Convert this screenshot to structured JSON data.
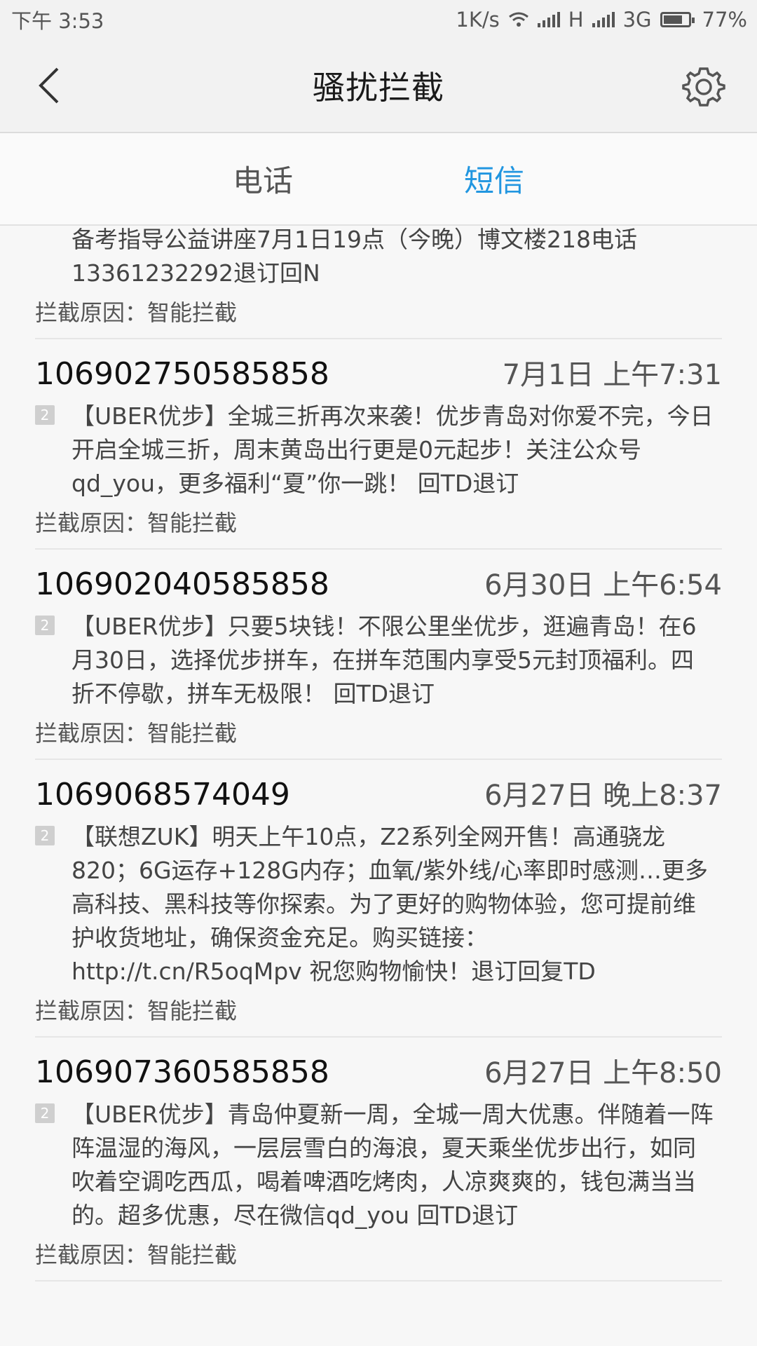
{
  "status_bar": {
    "time": "下午 3:53",
    "speed": "1K/s",
    "net1": "H",
    "net2": "3G",
    "battery": "77%",
    "battery_level": 0.77
  },
  "header": {
    "title": "骚扰拦截",
    "back_icon": "back-arrow-icon",
    "settings_icon": "gear-icon"
  },
  "tabs": [
    {
      "label": "电话",
      "active": false
    },
    {
      "label": "短信",
      "active": true
    }
  ],
  "messages": [
    {
      "number": "",
      "date": "",
      "sim": "",
      "text": "备考指导公益讲座7月1日19点（今晚）博文楼218电话13361232292退订回N",
      "reason": "拦截原因：智能拦截"
    },
    {
      "number": "106902750585858",
      "date": "7月1日 上午7:31",
      "sim": "2",
      "text": "【UBER优步】全城三折再次来袭！优步青岛对你爱不完，今日开启全城三折，周末黄岛出行更是0元起步！关注公众号qd_you，更多福利“夏”你一跳！ 回TD退订",
      "reason": "拦截原因：智能拦截"
    },
    {
      "number": "106902040585858",
      "date": "6月30日 上午6:54",
      "sim": "2",
      "text": "【UBER优步】只要5块钱！不限公里坐优步，逛遍青岛！在6月30日，选择优步拼车，在拼车范围内享受5元封顶福利。四折不停歇，拼车无极限！ 回TD退订",
      "reason": "拦截原因：智能拦截"
    },
    {
      "number": "1069068574049",
      "date": "6月27日 晚上8:37",
      "sim": "2",
      "text": "【联想ZUK】明天上午10点，Z2系列全网开售！高通骁龙820；6G运存+128G内存；血氧/紫外线/心率即时感测…更多高科技、黑科技等你探索。为了更好的购物体验，您可提前维护收货地址，确保资金充足。购买链接：http://t.cn/R5oqMpv 祝您购物愉快！退订回复TD",
      "reason": "拦截原因：智能拦截"
    },
    {
      "number": "106907360585858",
      "date": "6月27日 上午8:50",
      "sim": "2",
      "text": "【UBER优步】青岛仲夏新一周，全城一周大优惠。伴随着一阵阵温湿的海风，一层层雪白的海浪，夏天乘坐优步出行，如同吹着空调吃西瓜，喝着啤酒吃烤肉，人凉爽爽的，钱包满当当的。超多优惠，尽在微信qd_you 回TD退订",
      "reason": "拦截原因：智能拦截"
    }
  ]
}
